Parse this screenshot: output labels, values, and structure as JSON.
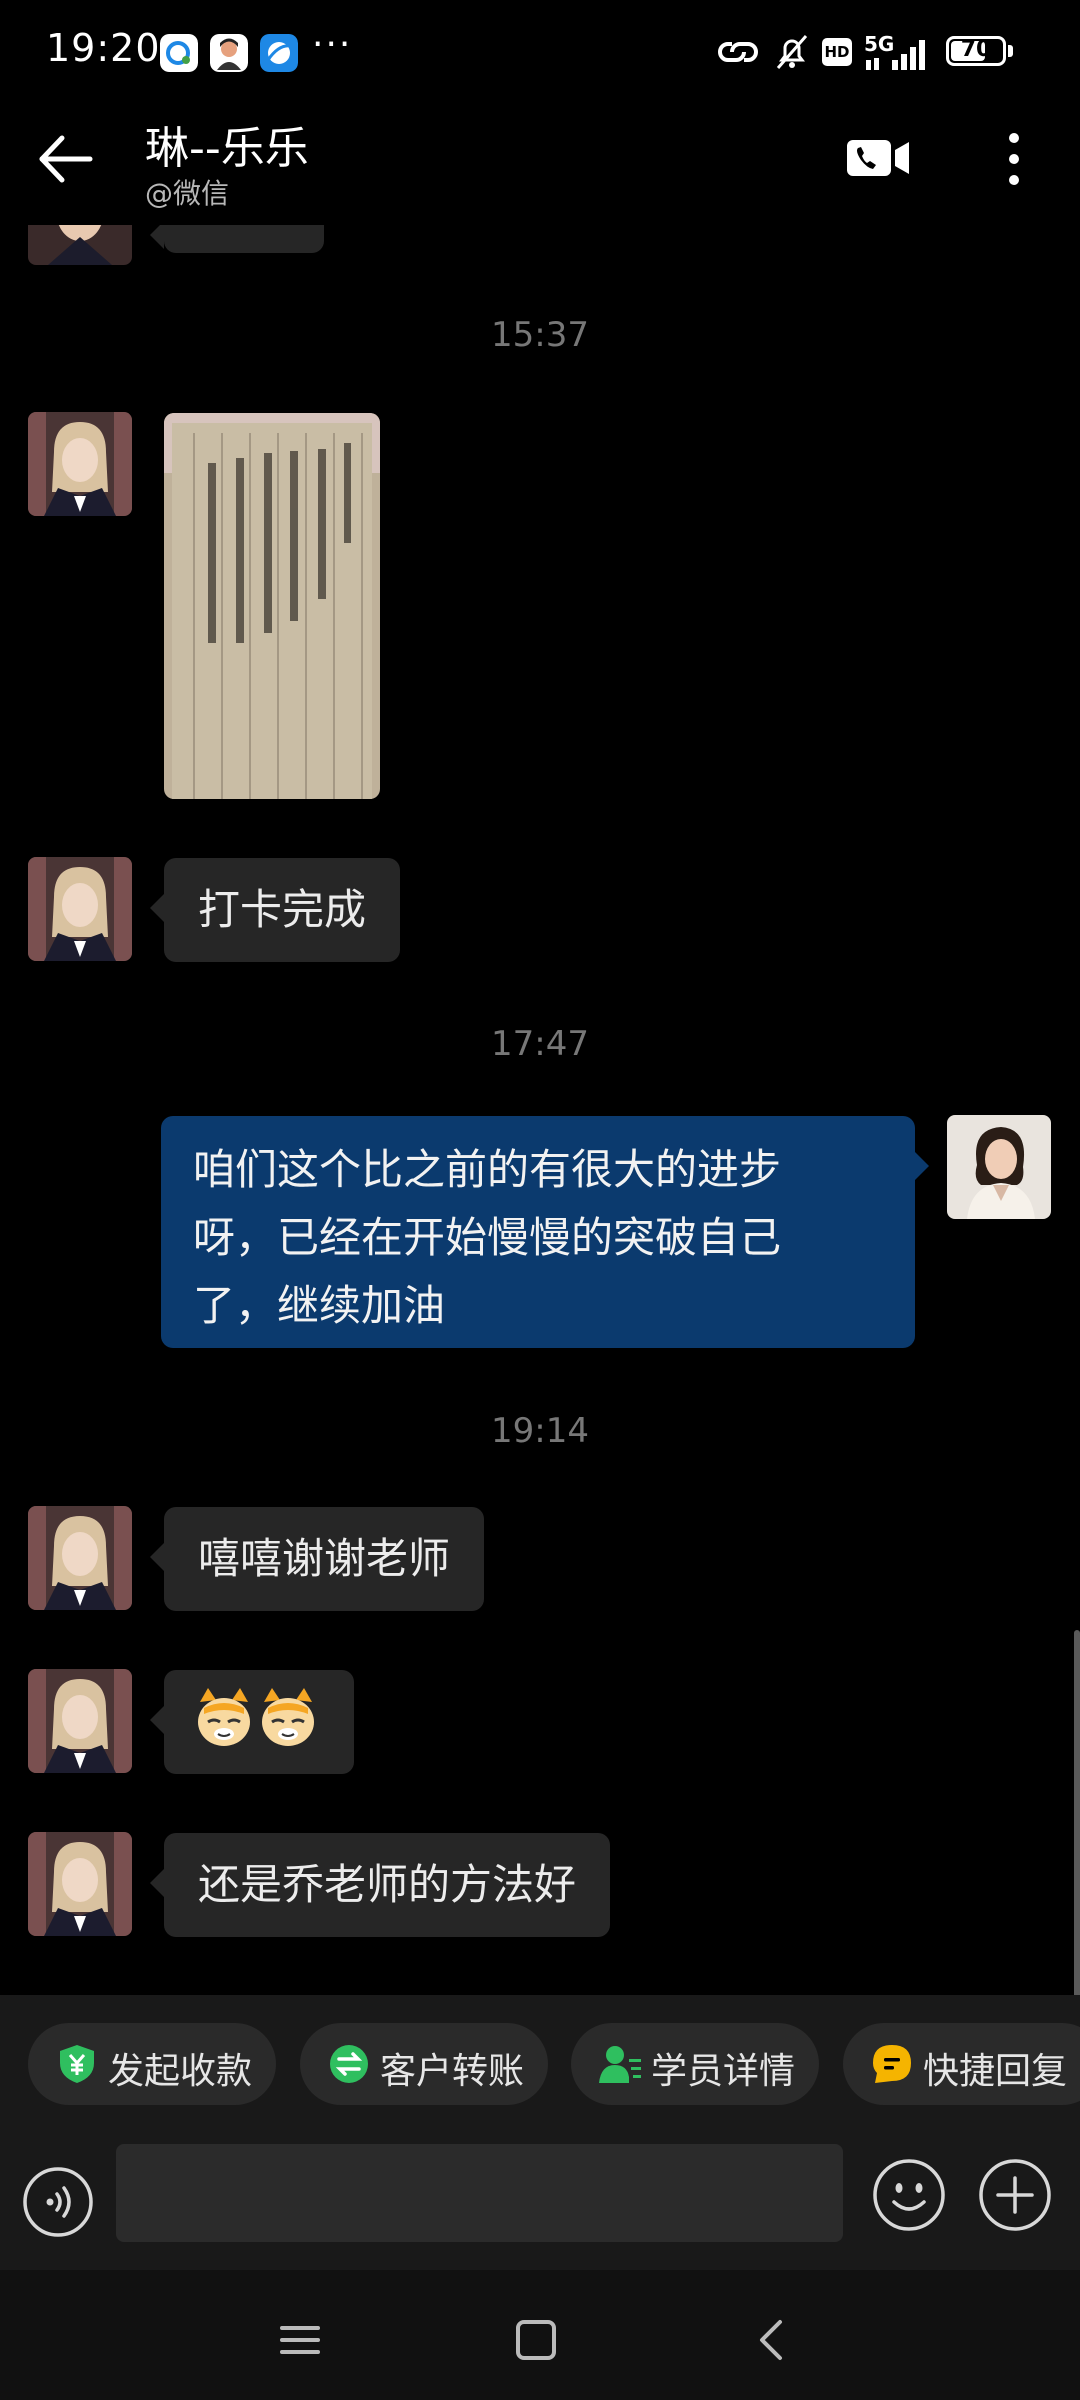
{
  "status_bar": {
    "time": "19:20",
    "dots": "···",
    "network": "5G",
    "hd": "HD",
    "battery": "70",
    "battery_level": 0.7
  },
  "header": {
    "title": "琳--乐乐",
    "subtitle": "@微信"
  },
  "chat": {
    "messages": [
      {
        "type": "timestamp",
        "text": "15:37"
      },
      {
        "type": "image",
        "side": "left"
      },
      {
        "type": "text",
        "side": "left",
        "text": "打卡完成"
      },
      {
        "type": "timestamp",
        "text": "17:47"
      },
      {
        "type": "text",
        "side": "right",
        "lines": [
          "咱们这个比之前的有很大的进步",
          "呀，已经在开始慢慢的突破自己",
          "了，继续加油"
        ]
      },
      {
        "type": "timestamp",
        "text": "19:14"
      },
      {
        "type": "text",
        "side": "left",
        "text": "嘻嘻谢谢老师"
      },
      {
        "type": "emoji",
        "side": "left",
        "emojis": [
          "cat-face-emoji",
          "cat-face-emoji"
        ]
      },
      {
        "type": "text",
        "side": "left",
        "text": "还是乔老师的方法好"
      }
    ]
  },
  "quick_actions": [
    {
      "label": "发起收款",
      "icon": "shield-yen-icon",
      "color": "#2fbf5f"
    },
    {
      "label": "客户转账",
      "icon": "transfer-icon",
      "color": "#2fbf5f"
    },
    {
      "label": "学员详情",
      "icon": "user-detail-icon",
      "color": "#2fbf5f"
    },
    {
      "label": "快捷回复",
      "icon": "quick-reply-icon",
      "color": "#f5b400"
    }
  ],
  "input_bar": {
    "value": "",
    "placeholder": ""
  },
  "colors": {
    "background": "#000000",
    "bubble_left": "#262626",
    "bubble_right": "#0b3a6e",
    "accent_green": "#2fbf5f"
  }
}
